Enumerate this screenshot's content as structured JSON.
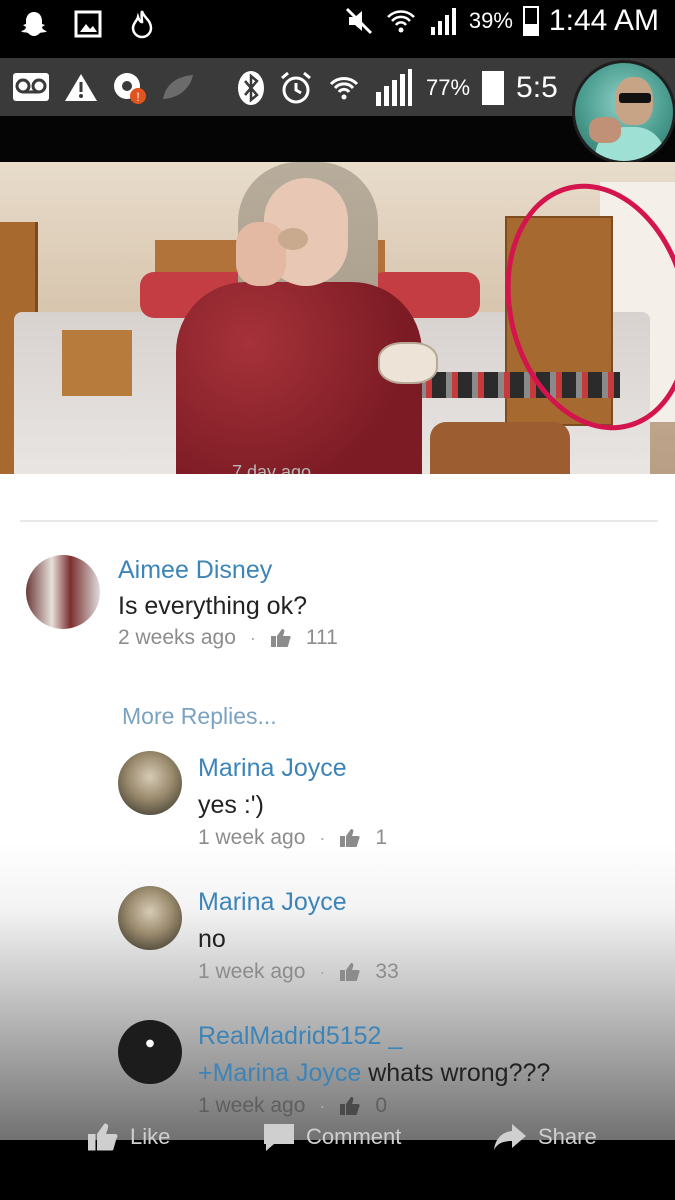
{
  "status_outer": {
    "icons_left": [
      "snapchat-icon",
      "gallery-icon",
      "flame-icon"
    ],
    "battery_pct": "39%",
    "time": "1:44 AM"
  },
  "status_inner": {
    "icons_left": [
      "voicemail-icon",
      "warning-icon",
      "app-notification-icon",
      "leaf-icon"
    ],
    "battery_pct": "77%",
    "time": "5:5"
  },
  "video": {
    "caption_fragment": "7 day ago"
  },
  "comments": {
    "top": {
      "author": "Aimee Disney",
      "text": "Is everything ok?",
      "time": "2 weeks ago",
      "likes": "111"
    },
    "more_replies_label": "More Replies...",
    "replies": [
      {
        "author": "Marina Joyce",
        "text": "yes :')",
        "time": "1 week ago",
        "likes": "1"
      },
      {
        "author": "Marina Joyce",
        "text": "no",
        "time": "1 week ago",
        "likes": "33"
      },
      {
        "author": "RealMadrid5152 _",
        "mention": "+Marina Joyce",
        "text": " whats wrong???",
        "time": "1 week ago",
        "likes": "0"
      }
    ]
  },
  "actions": {
    "like": "Like",
    "comment": "Comment",
    "share": "Share"
  },
  "colors": {
    "link_blue": "#3d84b8",
    "circle_red": "#d4144d"
  }
}
